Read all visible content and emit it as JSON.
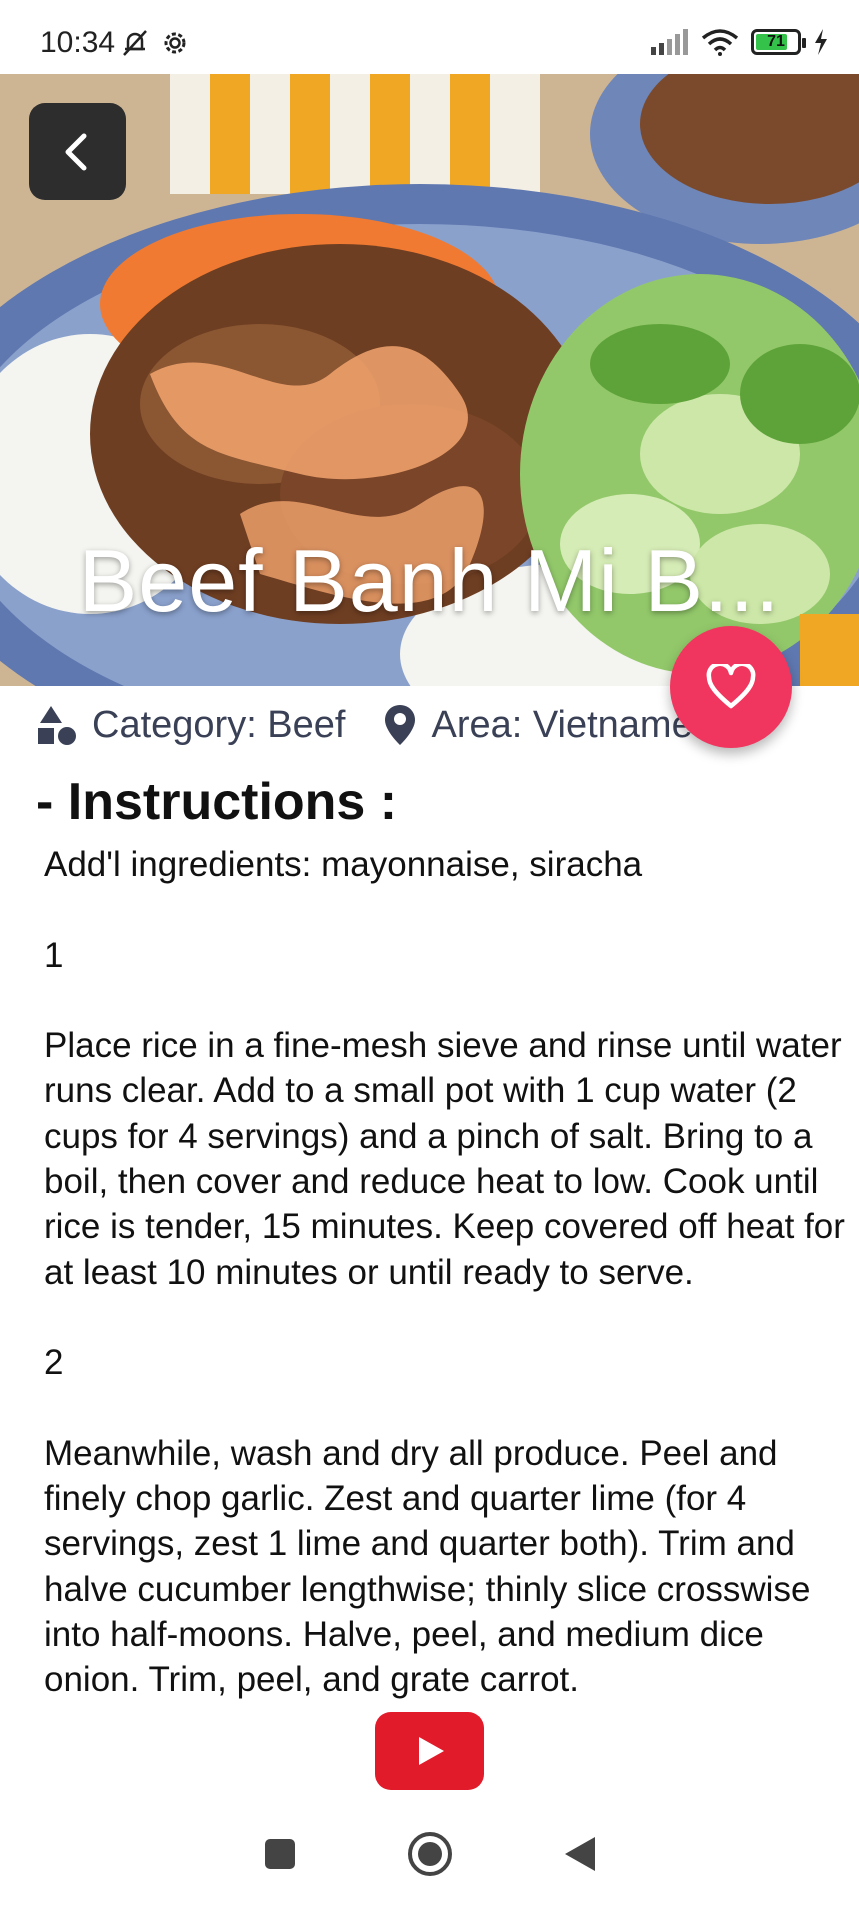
{
  "status_bar": {
    "time": "10:34",
    "battery_level": "71"
  },
  "meal": {
    "title": "Beef Banh Mi B...",
    "category_label": "Category: Beef",
    "area_label": "Area: Vietname"
  },
  "instructions": {
    "heading": "- Instructions :",
    "text": "Add'l ingredients: mayonnaise, siracha\n\n1\n\nPlace rice in a fine-mesh sieve and rinse until water runs clear. Add to a small pot with 1 cup water (2 cups for 4 servings) and a pinch of salt. Bring to a boil, then cover and reduce heat to low. Cook until rice is tender, 15 minutes. Keep covered off heat for at least 10 minutes or until ready to serve.\n\n2\n\nMeanwhile, wash and dry all produce. Peel and finely chop garlic. Zest and quarter lime (for 4 servings, zest 1 lime and quarter both). Trim and halve cucumber lengthwise; thinly slice crosswise into half-moons. Halve, peel, and medium dice onion. Trim, peel, and grate carrot."
  },
  "icons": {
    "back": "chevron-left-icon",
    "favorite": "heart-icon",
    "category": "shapes-icon",
    "area": "location-pin-icon",
    "youtube": "play-icon",
    "nav_recents": "square-icon",
    "nav_home": "circle-icon",
    "nav_back": "triangle-back-icon"
  },
  "colors": {
    "favorite_button": "#f0365e",
    "youtube_button": "#e21b2a",
    "back_button": "#2d2d2d",
    "meta_text": "#3a4156"
  }
}
